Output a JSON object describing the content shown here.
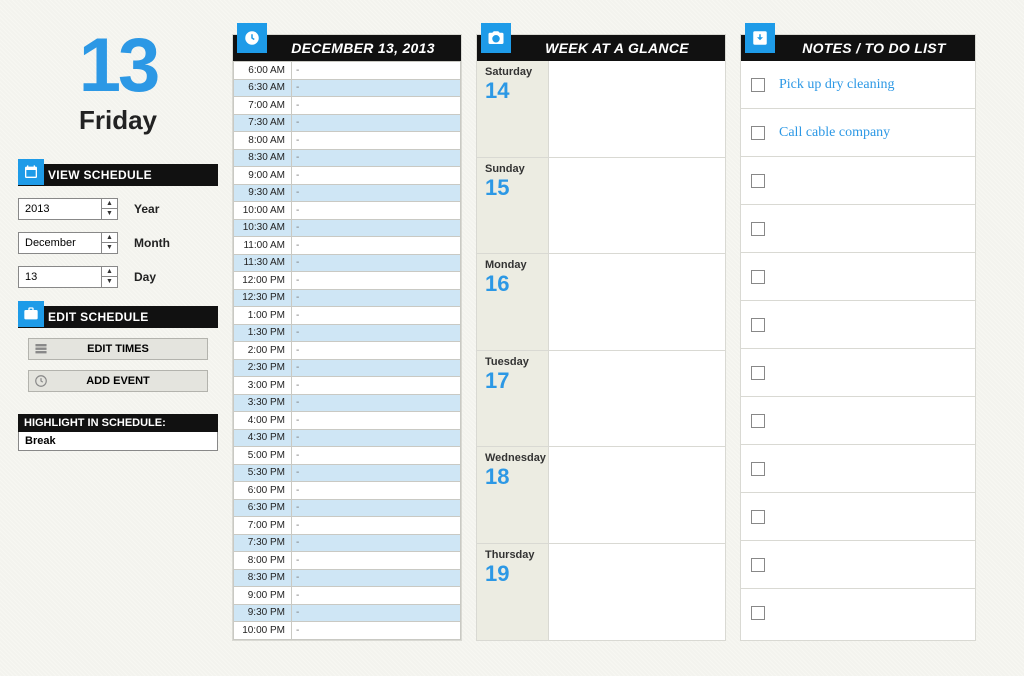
{
  "header": {
    "big_date": "13",
    "weekday": "Friday"
  },
  "view_schedule": {
    "title": "VIEW SCHEDULE",
    "year": {
      "value": "2013",
      "label": "Year"
    },
    "month": {
      "value": "December",
      "label": "Month"
    },
    "day": {
      "value": "13",
      "label": "Day"
    }
  },
  "edit_schedule": {
    "title": "EDIT SCHEDULE",
    "edit_times": "EDIT TIMES",
    "add_event": "ADD EVENT"
  },
  "highlight": {
    "title": "HIGHLIGHT IN SCHEDULE:",
    "item": "Break"
  },
  "schedule": {
    "title": "DECEMBER 13, 2013",
    "slots": [
      {
        "time": "6:00 AM",
        "tint": false
      },
      {
        "time": "6:30 AM",
        "tint": true
      },
      {
        "time": "7:00 AM",
        "tint": false
      },
      {
        "time": "7:30 AM",
        "tint": true
      },
      {
        "time": "8:00 AM",
        "tint": false
      },
      {
        "time": "8:30 AM",
        "tint": true
      },
      {
        "time": "9:00 AM",
        "tint": false
      },
      {
        "time": "9:30 AM",
        "tint": true
      },
      {
        "time": "10:00 AM",
        "tint": false
      },
      {
        "time": "10:30 AM",
        "tint": true
      },
      {
        "time": "11:00 AM",
        "tint": false
      },
      {
        "time": "11:30 AM",
        "tint": true
      },
      {
        "time": "12:00 PM",
        "tint": false
      },
      {
        "time": "12:30 PM",
        "tint": true
      },
      {
        "time": "1:00 PM",
        "tint": false
      },
      {
        "time": "1:30 PM",
        "tint": true
      },
      {
        "time": "2:00 PM",
        "tint": false
      },
      {
        "time": "2:30 PM",
        "tint": true
      },
      {
        "time": "3:00 PM",
        "tint": false
      },
      {
        "time": "3:30 PM",
        "tint": true
      },
      {
        "time": "4:00 PM",
        "tint": false
      },
      {
        "time": "4:30 PM",
        "tint": true
      },
      {
        "time": "5:00 PM",
        "tint": false
      },
      {
        "time": "5:30 PM",
        "tint": true
      },
      {
        "time": "6:00 PM",
        "tint": false
      },
      {
        "time": "6:30 PM",
        "tint": true
      },
      {
        "time": "7:00 PM",
        "tint": false
      },
      {
        "time": "7:30 PM",
        "tint": true
      },
      {
        "time": "8:00 PM",
        "tint": false
      },
      {
        "time": "8:30 PM",
        "tint": true
      },
      {
        "time": "9:00 PM",
        "tint": false
      },
      {
        "time": "9:30 PM",
        "tint": true
      },
      {
        "time": "10:00 PM",
        "tint": false
      }
    ]
  },
  "week": {
    "title": "WEEK AT A GLANCE",
    "days": [
      {
        "name": "Saturday",
        "num": "14"
      },
      {
        "name": "Sunday",
        "num": "15"
      },
      {
        "name": "Monday",
        "num": "16"
      },
      {
        "name": "Tuesday",
        "num": "17"
      },
      {
        "name": "Wednesday",
        "num": "18"
      },
      {
        "name": "Thursday",
        "num": "19"
      }
    ]
  },
  "notes": {
    "title": "NOTES / TO DO LIST",
    "items": [
      {
        "text": "Pick up dry cleaning"
      },
      {
        "text": "Call cable company"
      },
      {
        "text": ""
      },
      {
        "text": ""
      },
      {
        "text": ""
      },
      {
        "text": ""
      },
      {
        "text": ""
      },
      {
        "text": ""
      },
      {
        "text": ""
      },
      {
        "text": ""
      },
      {
        "text": ""
      },
      {
        "text": ""
      }
    ]
  }
}
